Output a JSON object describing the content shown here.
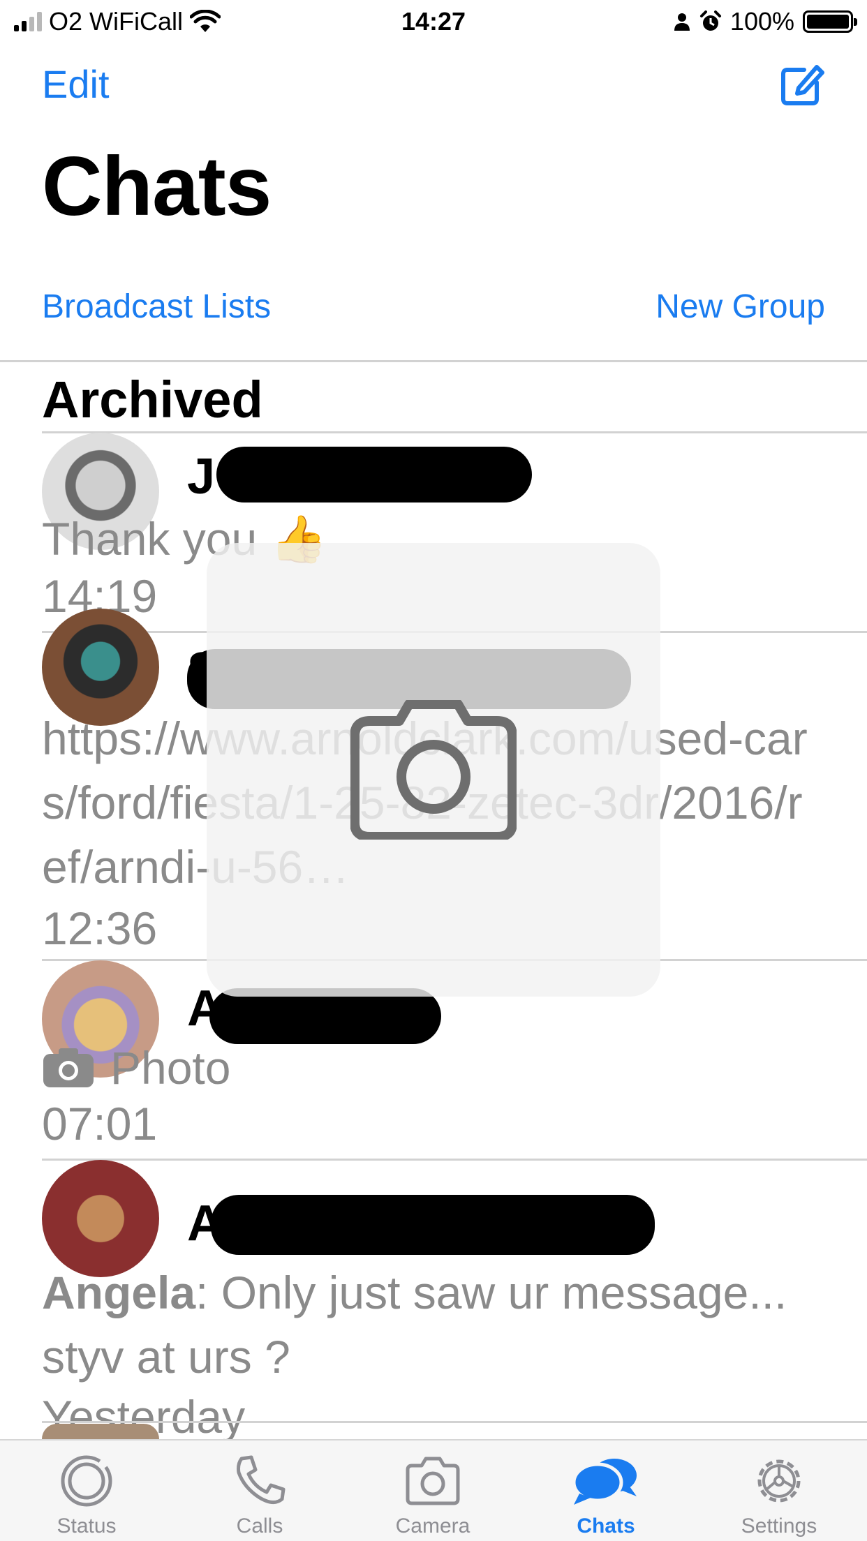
{
  "status_bar": {
    "carrier": "O2 WiFiCall",
    "time": "14:27",
    "battery": "100%"
  },
  "nav": {
    "edit_label": "Edit",
    "title": "Chats",
    "broadcast_label": "Broadcast Lists",
    "new_group_label": "New Group"
  },
  "archived_label": "Archived",
  "chats": [
    {
      "name": "J",
      "preview": "Thank you 👍",
      "time": "14:19"
    },
    {
      "name": "S",
      "preview": "https://www.arnoldclark.com/used-cars/ford/fiesta/1-25-82-zetec-3dr/2016/ref/arndi-u-56…",
      "time": "12:36"
    },
    {
      "name": "A",
      "preview_icon": "camera-icon",
      "preview": "Photo",
      "time": "07:01"
    },
    {
      "name": "A",
      "preview_sender": "Angela",
      "preview": ": Only just saw ur message... styv at urs ?",
      "time": "Yesterday"
    }
  ],
  "tabs": [
    {
      "label": "Status",
      "icon": "status-icon",
      "active": false
    },
    {
      "label": "Calls",
      "icon": "phone-icon",
      "active": false
    },
    {
      "label": "Camera",
      "icon": "camera-icon",
      "active": false
    },
    {
      "label": "Chats",
      "icon": "chats-icon",
      "active": true
    },
    {
      "label": "Settings",
      "icon": "gear-icon",
      "active": false
    }
  ],
  "colors": {
    "accent": "#1a7cf0",
    "secondary_text": "#8a8a8a",
    "tab_inactive": "#8e8e93"
  }
}
